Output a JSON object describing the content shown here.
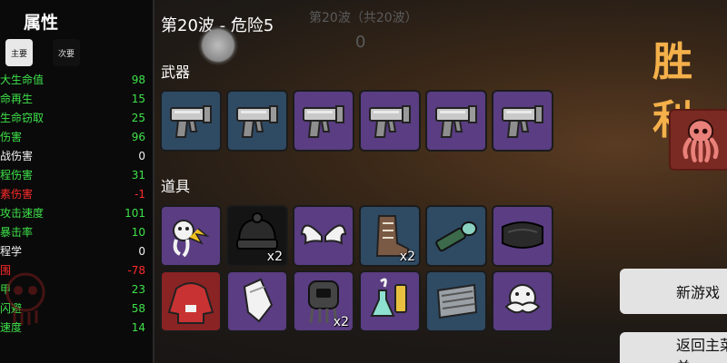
{
  "stats": {
    "title": "属性",
    "tab_main": "主要",
    "tab_secondary": "次要",
    "rows": [
      {
        "label": "大生命值",
        "value": "98",
        "color": "green"
      },
      {
        "label": "命再生",
        "value": "15",
        "color": "green"
      },
      {
        "label": "生命窃取",
        "value": "25",
        "color": "green"
      },
      {
        "label": "伤害",
        "value": "96",
        "color": "green"
      },
      {
        "label": "战伤害",
        "value": "0",
        "color": "white"
      },
      {
        "label": "程伤害",
        "value": "31",
        "color": "green"
      },
      {
        "label": "素伤害",
        "value": "-1",
        "color": "red"
      },
      {
        "label": "攻击速度",
        "value": "101",
        "color": "green"
      },
      {
        "label": "暴击率",
        "value": "10",
        "color": "green"
      },
      {
        "label": "程学",
        "value": "0",
        "color": "white"
      },
      {
        "label": "围",
        "value": "-78",
        "color": "red"
      },
      {
        "label": "甲",
        "value": "23",
        "color": "green"
      },
      {
        "label": "闪避",
        "value": "58",
        "color": "green"
      },
      {
        "label": "速度",
        "value": "14",
        "color": "green"
      }
    ]
  },
  "wave": {
    "title": "第20波 - 危险5",
    "count_label": "第20波（共20波）",
    "count_value": "0"
  },
  "weapons": {
    "label": "武器",
    "slots": [
      {
        "icon": "gun-icon",
        "rarity": "blue"
      },
      {
        "icon": "gun-icon",
        "rarity": "blue"
      },
      {
        "icon": "gun-icon",
        "rarity": "purple"
      },
      {
        "icon": "gun-icon",
        "rarity": "purple"
      },
      {
        "icon": "gun-icon",
        "rarity": "purple"
      },
      {
        "icon": "gun-icon",
        "rarity": "purple"
      }
    ]
  },
  "items": {
    "label": "道具",
    "slots": [
      {
        "icon": "ghost-creature-icon",
        "rarity": "purple",
        "qty": ""
      },
      {
        "icon": "beanie-hat-icon",
        "rarity": "black",
        "qty": "x2"
      },
      {
        "icon": "wings-icon",
        "rarity": "purple",
        "qty": ""
      },
      {
        "icon": "boot-icon",
        "rarity": "blue",
        "qty": "x2"
      },
      {
        "icon": "flashlight-icon",
        "rarity": "blue",
        "qty": ""
      },
      {
        "icon": "scarf-icon",
        "rarity": "purple",
        "qty": ""
      },
      {
        "icon": "hoodie-icon",
        "rarity": "red",
        "qty": ""
      },
      {
        "icon": "glove-icon",
        "rarity": "purple",
        "qty": ""
      },
      {
        "icon": "diving-helmet-icon",
        "rarity": "purple",
        "qty": "x2"
      },
      {
        "icon": "potion-icon",
        "rarity": "purple",
        "qty": ""
      },
      {
        "icon": "armor-icon",
        "rarity": "blue",
        "qty": ""
      },
      {
        "icon": "mustache-icon",
        "rarity": "purple",
        "qty": ""
      }
    ]
  },
  "victory": {
    "title": "胜利",
    "enemy_icon": "octopus-icon"
  },
  "buttons": {
    "new_game": "新游戏",
    "back_menu": "返回主菜单"
  },
  "colors": {
    "green": "#3ee24a",
    "white": "#f2f2f2",
    "red": "#ff2b2b",
    "purple": "#5a3d82",
    "blue": "#2f4a63",
    "black": "#141414",
    "rarity_red": "#8a2323",
    "victory": "#f4b04a"
  }
}
